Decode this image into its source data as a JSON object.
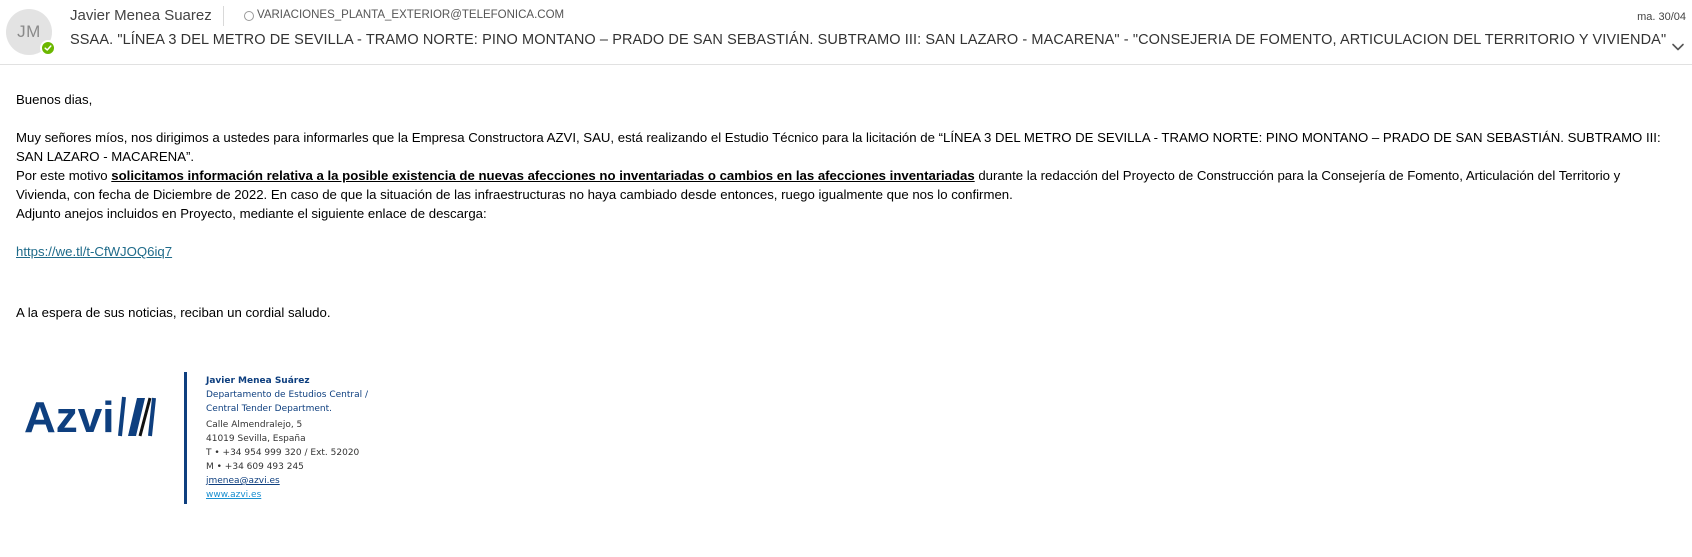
{
  "header": {
    "avatar_initials": "JM",
    "sender_name": "Javier Menea Suarez",
    "recipient": "VARIACIONES_PLANTA_EXTERIOR@TELEFONICA.COM",
    "date": "ma. 30/04",
    "subject": "SSAA. \"LÍNEA 3 DEL METRO DE SEVILLA - TRAMO NORTE: PINO MONTANO – PRADO DE SAN SEBASTIÁN. SUBTRAMO III: SAN LAZARO - MACARENA\" - \"CONSEJERIA DE FOMENTO, ARTICULACION DEL TERRITORIO Y VIVIENDA\"",
    "presence_color": "#6bb700",
    "icons": {
      "presence": "presence-available-icon",
      "status": "status-ring-icon",
      "expand": "chevron-down-icon"
    }
  },
  "body": {
    "greeting": "Buenos dias,",
    "paragraph1": "Muy señores míos, nos dirigimos a ustedes para informarles que la Empresa Constructora AZVI, SAU, está realizando el Estudio Técnico para la licitación de “LÍNEA 3 DEL METRO DE SEVILLA - TRAMO NORTE: PINO MONTANO – PRADO DE SAN SEBASTIÁN. SUBTRAMO III: SAN LAZARO - MACARENA”.",
    "paragraph2_prefix": "Por este motivo ",
    "paragraph2_bold": "solicitamos información relativa a la posible existencia de nuevas afecciones no inventariadas o cambios en las afecciones inventariadas",
    "paragraph2_suffix": " durante la redacción del Proyecto de Construcción para la Consejería de Fomento, Articulación del Territorio y Vivienda, con fecha de Diciembre de 2022. En caso de que la situación de las infraestructuras no haya cambiado desde entonces, ruego igualmente que nos lo confirmen.",
    "paragraph3": "Adjunto anejos incluidos en Proyecto, mediante el siguiente enlace de descarga:",
    "download_link": "https://we.tl/t-CfWJOQ6iq7",
    "closing": "A la espera de sus noticias, reciban un cordial saludo."
  },
  "signature": {
    "logo_text": "Azvi",
    "logo_color": "#0e3f7f",
    "name": "Javier Menea Suárez",
    "dept_line1": "Departamento de Estudios Central /",
    "dept_line2": "Central Tender Department.",
    "address_line1": "Calle Almendralejo, 5",
    "address_line2": "41019 Sevilla, España",
    "phone": "T •  +34 954 999 320 / Ext. 52020",
    "mobile": "M •  +34 609 493 245",
    "email": "jmenea@azvi.es",
    "website": "www.azvi.es"
  }
}
